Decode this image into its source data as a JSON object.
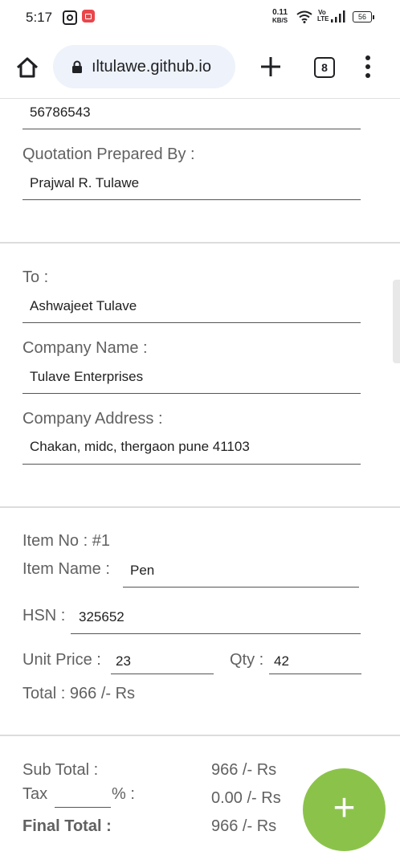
{
  "status_bar": {
    "time": "5:17",
    "net_speed_value": "0.11",
    "net_speed_unit": "KB/S",
    "volte": "Vo LTE",
    "battery": "56"
  },
  "browser": {
    "url": "ıltulawe.github.io",
    "tab_count": "8"
  },
  "from": {
    "phone_value": "56786543",
    "prepared_by_label": "Quotation Prepared By :",
    "prepared_by_value": "Prajwal R. Tulawe"
  },
  "to": {
    "to_label": "To :",
    "to_value": "Ashwajeet Tulave",
    "company_name_label": "Company Name :",
    "company_name_value": "Tulave Enterprises",
    "company_address_label": "Company Address :",
    "company_address_value": "Chakan, midc, thergaon pune 41103"
  },
  "item": {
    "item_no": "Item No : #1",
    "item_name_label": "Item Name :",
    "item_name_value": "Pen",
    "hsn_label": "HSN :",
    "hsn_value": "325652",
    "unit_price_label": "Unit Price :",
    "unit_price_value": "23",
    "qty_label": "Qty :",
    "qty_value": "42",
    "total": "Total : 966 /- Rs"
  },
  "summary": {
    "subtotal_label": "Sub Total :",
    "subtotal_value": "966 /- Rs",
    "tax_label": "Tax",
    "tax_percent_suffix": "% :",
    "tax_value": "0.00 /- Rs",
    "final_label": "Final Total :",
    "final_value": "966 /- Rs"
  },
  "fab": {
    "label": "+"
  },
  "colors": {
    "accent": "#8bc34a",
    "url_pill": "#eef2fb",
    "separator": "#dcdcdc",
    "label_gray": "#616161"
  },
  "icons": {
    "home": "home-icon",
    "lock": "lock-icon",
    "new_tab": "plus-icon",
    "menu": "more-vert-icon"
  }
}
